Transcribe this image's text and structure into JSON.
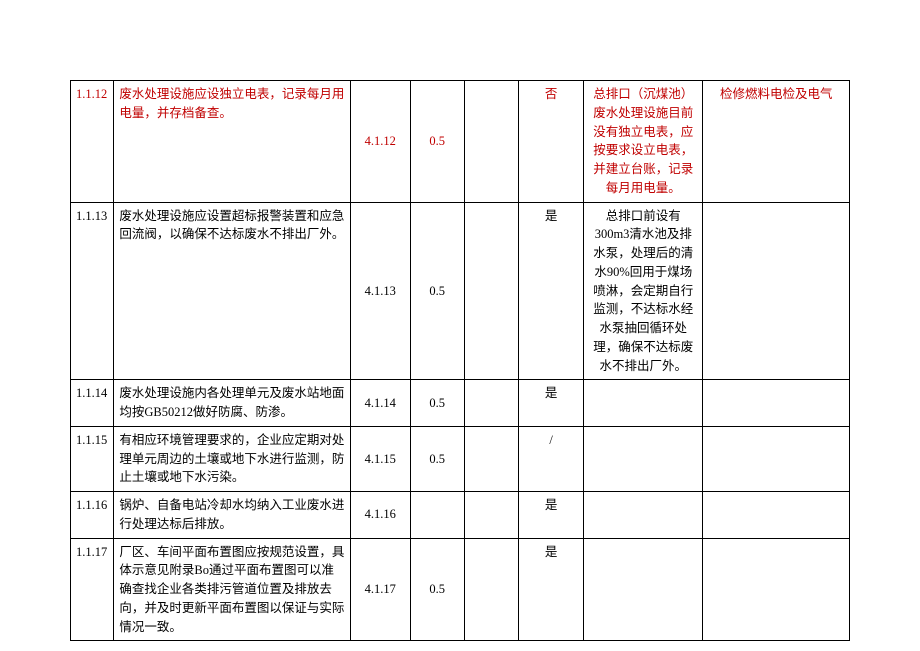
{
  "rows": [
    {
      "num": "1.1.12",
      "desc": "废水处理设施应设独立电表，记录每月用电量，并存档备查。",
      "ref": "4.1.12",
      "score": "0.5",
      "c5": "",
      "compliance": "否",
      "status": "总排口（沉煤池）废水处理设施目前没有独立电表，应按要求设立电表，并建立台账，记录每月用电量。",
      "responsible": "检修燃料电检及电气",
      "highlight": true
    },
    {
      "num": "1.1.13",
      "desc": "废水处理设施应设置超标报警装置和应急回流阀，以确保不达标废水不排出厂外。",
      "ref": "4.1.13",
      "score": "0.5",
      "c5": "",
      "compliance": "是",
      "status": "总排口前设有300m3清水池及排水泵，处理后的清水90%回用于煤场喷淋，会定期自行监测，不达标水经水泵抽回循环处理，确保不达标废水不排出厂外。",
      "responsible": "",
      "highlight": false
    },
    {
      "num": "1.1.14",
      "desc": "废水处理设施内各处理单元及废水站地面均按GB50212做好防腐、防渗。",
      "ref": "4.1.14",
      "score": "0.5",
      "c5": "",
      "compliance": "是",
      "status": "",
      "responsible": "",
      "highlight": false
    },
    {
      "num": "1.1.15",
      "desc": "有相应环境管理要求的，企业应定期对处理单元周边的土壤或地下水进行监测，防止土壤或地下水污染。",
      "ref": "4.1.15",
      "score": "0.5",
      "c5": "",
      "compliance": "/",
      "status": "",
      "responsible": "",
      "highlight": false
    },
    {
      "num": "1.1.16",
      "desc": "锅炉、自备电站冷却水均纳入工业废水进行处理达标后排放。",
      "ref": "4.1.16",
      "score": "",
      "c5": "",
      "compliance": "是",
      "status": "",
      "responsible": "",
      "highlight": false
    },
    {
      "num": "1.1.17",
      "desc": "厂区、车间平面布置图应按规范设置，具体示意见附录Bo通过平面布置图可以准确查找企业各类排污管道位置及排放去向，并及时更新平面布置图以保证与实际情况一致。",
      "ref": "4.1.17",
      "score": "0.5",
      "c5": "",
      "compliance": "是",
      "status": "",
      "responsible": "",
      "highlight": false
    }
  ]
}
